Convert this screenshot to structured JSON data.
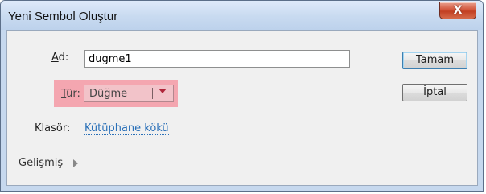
{
  "window": {
    "title": "Yeni Sembol Oluştur",
    "close_glyph": "X"
  },
  "form": {
    "name_label_access_key": "A",
    "name_label_rest": "d:",
    "name_value": "dugme1",
    "type_label_access_key": "T",
    "type_label_rest": "ür:",
    "type_value": "Düğme",
    "folder_label": "Klasör:",
    "folder_value": "Kütüphane kökü",
    "advanced_label": "Gelişmiş"
  },
  "buttons": {
    "ok_label": "Tamam",
    "cancel_label": "İptal"
  },
  "colors": {
    "highlight": "#f4a6b0",
    "link": "#2a70b8",
    "titlebar": "#c8daf0"
  },
  "icons": {
    "close": "close-icon",
    "dropdown": "chevron-down-icon",
    "expand": "triangle-right-icon"
  }
}
